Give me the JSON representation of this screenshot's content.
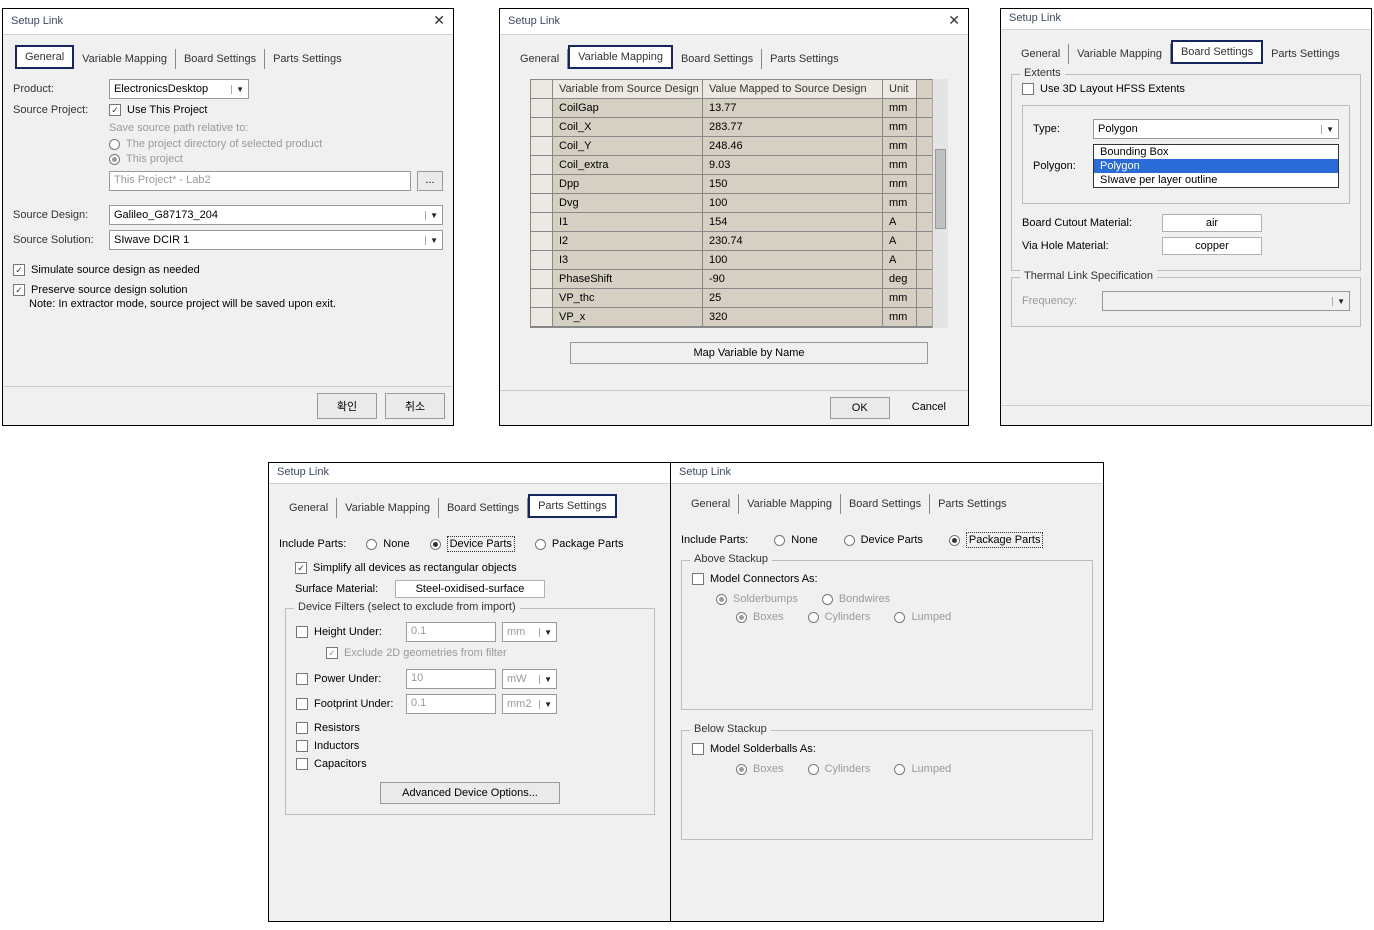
{
  "title": "Setup Link",
  "tabs": {
    "general": "General",
    "varmap": "Variable Mapping",
    "board": "Board Settings",
    "parts": "Parts Settings"
  },
  "d1": {
    "product_lbl": "Product:",
    "product_val": "ElectronicsDesktop",
    "sourceproj_lbl": "Source Project:",
    "use_this_project": "Use This Project",
    "save_rel": "Save source path relative to:",
    "opt_projdir": "The project directory of selected product",
    "opt_thisproj": "This project",
    "proj_field": "This Project* - Lab2",
    "browse": "...",
    "source_design_lbl": "Source Design:",
    "source_design_val": "Galileo_G87173_204",
    "source_sol_lbl": "Source Solution:",
    "source_sol_val": "SIwave DCIR 1",
    "simulate": "Simulate source design as needed",
    "preserve": "Preserve source design solution",
    "note": "Note: In extractor mode, source project will be saved upon exit.",
    "ok": "확인",
    "cancel": "취소"
  },
  "d2": {
    "col_var": "Variable from Source Design",
    "col_val": "Value Mapped to Source Design",
    "col_unit": "Unit",
    "rows": [
      {
        "v": "CoilGap",
        "val": "13.77",
        "u": "mm"
      },
      {
        "v": "Coil_X",
        "val": "283.77",
        "u": "mm"
      },
      {
        "v": "Coil_Y",
        "val": "248.46",
        "u": "mm"
      },
      {
        "v": "Coil_extra",
        "val": "9.03",
        "u": "mm"
      },
      {
        "v": "Dpp",
        "val": "150",
        "u": "mm"
      },
      {
        "v": "Dvg",
        "val": "100",
        "u": "mm"
      },
      {
        "v": "I1",
        "val": "154",
        "u": "A"
      },
      {
        "v": "I2",
        "val": "230.74",
        "u": "A"
      },
      {
        "v": "I3",
        "val": "100",
        "u": "A"
      },
      {
        "v": "PhaseShift",
        "val": "-90",
        "u": "deg"
      },
      {
        "v": "VP_thc",
        "val": "25",
        "u": "mm"
      },
      {
        "v": "VP_x",
        "val": "320",
        "u": "mm"
      }
    ],
    "map_btn": "Map Variable by Name",
    "ok": "OK",
    "cancel": "Cancel"
  },
  "d3": {
    "extents": "Extents",
    "use3d": "Use 3D Layout HFSS Extents",
    "type_lbl": "Type:",
    "type_val": "Polygon",
    "polygon_lbl": "Polygon:",
    "dd": {
      "bb": "Bounding Box",
      "poly": "Polygon",
      "siwave": "SIwave per layer outline"
    },
    "cutout_lbl": "Board Cutout Material:",
    "cutout_val": "air",
    "via_lbl": "Via Hole Material:",
    "via_val": "copper",
    "thermal": "Thermal Link Specification",
    "freq_lbl": "Frequency:"
  },
  "d4": {
    "include_lbl": "Include Parts:",
    "none": "None",
    "device": "Device Parts",
    "package": "Package Parts",
    "simplify": "Simplify all devices as rectangular objects",
    "surface_lbl": "Surface Material:",
    "surface_val": "Steel-oxidised-surface",
    "filters": "Device Filters (select to exclude from import)",
    "height_lbl": "Height Under:",
    "height_val": "0.1",
    "height_unit": "mm",
    "exclude2d": "Exclude 2D geometries from filter",
    "power_lbl": "Power Under:",
    "power_val": "10",
    "power_unit": "mW",
    "footprint_lbl": "Footprint Under:",
    "footprint_val": "0.1",
    "footprint_unit": "mm2",
    "resistors": "Resistors",
    "inductors": "Inductors",
    "capacitors": "Capacitors",
    "adv": "Advanced Device Options..."
  },
  "d5": {
    "above": "Above Stackup",
    "model_conn": "Model Connectors As:",
    "solder": "Solderbumps",
    "bond": "Bondwires",
    "boxes": "Boxes",
    "cyl": "Cylinders",
    "lumped": "Lumped",
    "below": "Below Stackup",
    "model_ball": "Model Solderballs As:"
  }
}
